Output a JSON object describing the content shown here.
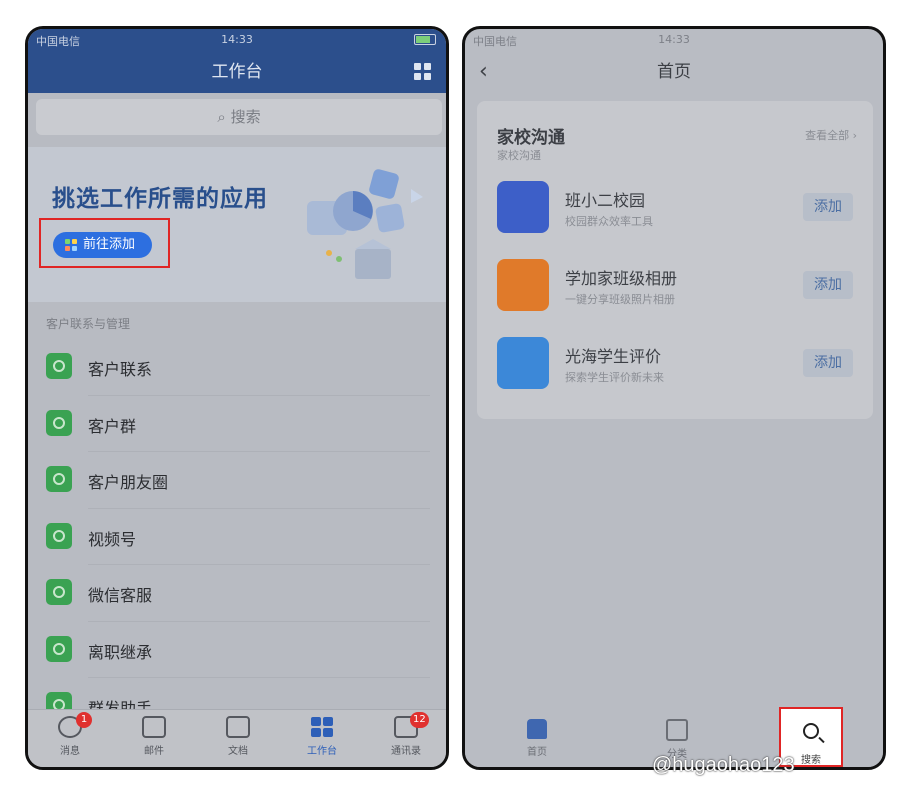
{
  "left": {
    "status": {
      "carrier": "中国电信",
      "time": "14:33"
    },
    "nav_title": "工作台",
    "search_placeholder": "搜索",
    "banner": {
      "title": "挑选工作所需的应用",
      "add_button": "前往添加"
    },
    "section_label": "客户联系与管理",
    "items": [
      {
        "label": "客户联系",
        "icon": "chat-icon"
      },
      {
        "label": "客户群",
        "icon": "group-icon"
      },
      {
        "label": "客户朋友圈",
        "icon": "moments-icon"
      },
      {
        "label": "视频号",
        "icon": "channels-icon"
      },
      {
        "label": "微信客服",
        "icon": "service-icon"
      },
      {
        "label": "离职继承",
        "icon": "inherit-icon"
      },
      {
        "label": "群发助手",
        "icon": "broadcast-icon"
      }
    ],
    "tabs": [
      {
        "label": "消息",
        "badge": "1"
      },
      {
        "label": "邮件",
        "badge": ""
      },
      {
        "label": "文档",
        "badge": ""
      },
      {
        "label": "工作台",
        "badge": ""
      },
      {
        "label": "通讯录",
        "badge": "12"
      }
    ],
    "colors": {
      "primary": "#2c4f8c",
      "accent": "#2d6fe0",
      "icon_green": "#3aa252",
      "highlight": "#e02525"
    }
  },
  "right": {
    "status": {
      "carrier": "中国电信",
      "time": "14:33"
    },
    "nav_title": "首页",
    "card": {
      "title": "家校沟通",
      "subtitle": "家校沟通",
      "view_all": "查看全部 ›",
      "apps": [
        {
          "name": "班小二校园",
          "desc": "校园群众效率工具",
          "button": "添加",
          "color": "#3d5fc8"
        },
        {
          "name": "学加家班级相册",
          "desc": "一键分享班级照片相册",
          "button": "添加",
          "color": "#e07a2a"
        },
        {
          "name": "光海学生评价",
          "desc": "探索学生评价新未来",
          "button": "添加",
          "color": "#3c88d8"
        }
      ]
    },
    "tabs": [
      {
        "label": "首页"
      },
      {
        "label": "分类"
      },
      {
        "label": "搜索"
      }
    ]
  },
  "watermark": "@hugaohao123"
}
